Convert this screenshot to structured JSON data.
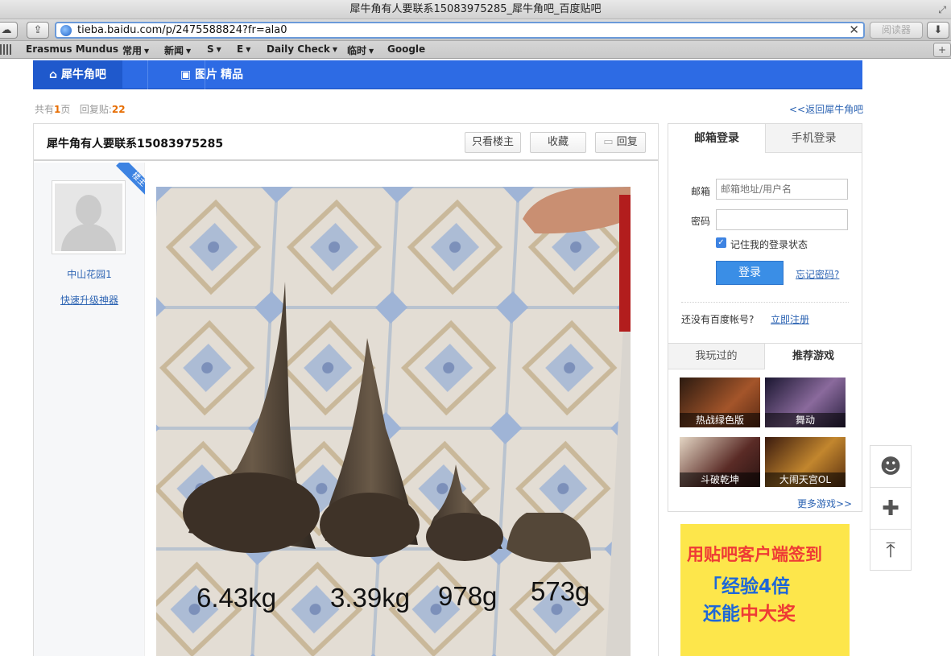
{
  "window": {
    "title": "犀牛角有人要联系15083975285_犀牛角吧_百度贴吧"
  },
  "browser": {
    "url": "tieba.baidu.com/p/2475588824?fr=ala0",
    "reader_label": "阅读器",
    "bookmarks": [
      "Erasmus Mundus",
      "常用",
      "新闻",
      "S",
      "E",
      "Daily Check",
      "临时",
      "Google"
    ]
  },
  "nav": {
    "home": "犀牛角吧",
    "images": "图片",
    "featured": "精品"
  },
  "thread_meta": {
    "pages_prefix": "共有",
    "pages": "1",
    "pages_suffix": "页",
    "replies_label": "回复贴:",
    "replies": "22",
    "back_link": "<<返回犀牛角吧"
  },
  "post": {
    "title": "犀牛角有人要联系15083975285",
    "buttons": {
      "only_op": "只看楼主",
      "favorite": "收藏",
      "reply": "回复"
    },
    "badge": "楼主",
    "author": "中山花园1",
    "upgrade_link": "快速升级神器",
    "photo_weights": [
      "6.43kg",
      "3.39kg",
      "978g",
      "573g"
    ]
  },
  "login": {
    "tab_email": "邮箱登录",
    "tab_phone": "手机登录",
    "email_label": "邮箱",
    "email_placeholder": "邮箱地址/用户名",
    "password_label": "密码",
    "remember": "记住我的登录状态",
    "submit": "登录",
    "forgot": "忘记密码?",
    "no_account": "还没有百度帐号?",
    "register": "立即注册"
  },
  "games": {
    "tab_played": "我玩过的",
    "tab_recommended": "推荐游戏",
    "items": [
      {
        "name": "热战绿色版",
        "color": "#7a3b1e"
      },
      {
        "name": "舞动",
        "color": "#3a2c52"
      },
      {
        "name": "斗破乾坤",
        "color": "#5a2b26"
      },
      {
        "name": "大闹天宫OL",
        "color": "#8a5a22"
      }
    ],
    "more": "更多游戏>>"
  },
  "ad": {
    "line1": "用贴吧客户端签到",
    "line2": "「经验4倍",
    "line3_prefix": "还能",
    "line3_highlight": "中大奖"
  },
  "colors": {
    "nav": "#2d6be4",
    "accent": "#3a8ee6",
    "link": "#2d64b3",
    "highlight": "#e66c00"
  }
}
